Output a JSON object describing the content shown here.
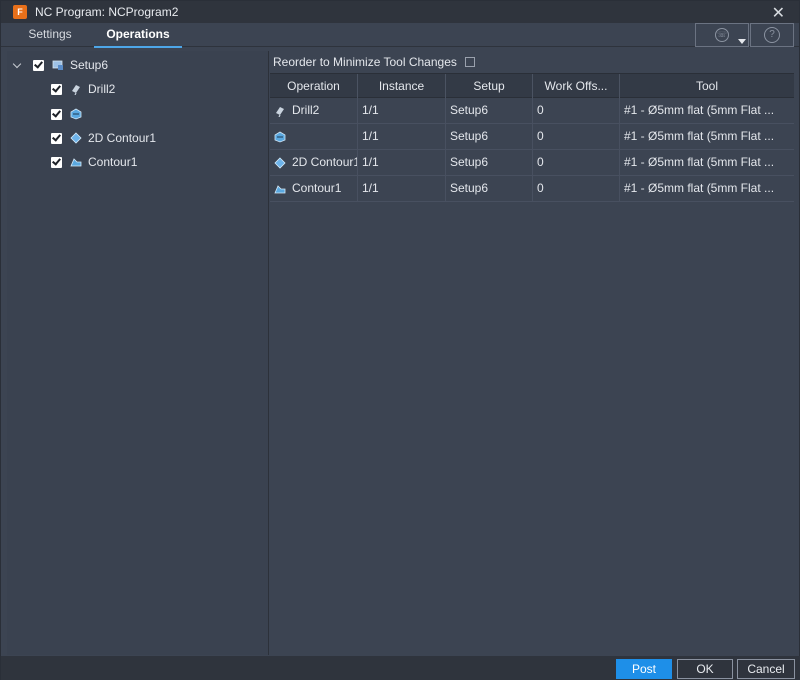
{
  "window": {
    "title": "NC Program: NCProgram2",
    "app_icon_letter": "F"
  },
  "tabs": [
    {
      "label": "Settings",
      "active": false
    },
    {
      "label": "Operations",
      "active": true
    }
  ],
  "toolbar": {
    "phone_icon": "phone-icon",
    "help_icon": "help-icon",
    "help_glyph": "?"
  },
  "tree": {
    "setup": {
      "label": "Setup6",
      "checked": true
    },
    "items": [
      {
        "label": "Drill2",
        "icon": "drill-icon",
        "checked": true
      },
      {
        "label": "",
        "icon": "3d-op-icon",
        "checked": true
      },
      {
        "label": "2D Contour1",
        "icon": "2d-contour-icon",
        "checked": true
      },
      {
        "label": "Contour1",
        "icon": "contour-icon",
        "checked": true
      }
    ]
  },
  "reorder": {
    "label": "Reorder to Minimize Tool Changes",
    "checked": false
  },
  "table": {
    "headers": [
      "Operation",
      "Instance",
      "Setup",
      "Work Offs...",
      "Tool"
    ],
    "rows": [
      {
        "operation": "Drill2",
        "instance": "1/1",
        "setup": "Setup6",
        "work_offset": "0",
        "tool": "#1 - Ø5mm flat (5mm Flat ..."
      },
      {
        "operation": "",
        "instance": "1/1",
        "setup": "Setup6",
        "work_offset": "0",
        "tool": "#1 - Ø5mm flat (5mm Flat ..."
      },
      {
        "operation": "2D Contour1",
        "instance": "1/1",
        "setup": "Setup6",
        "work_offset": "0",
        "tool": "#1 - Ø5mm flat (5mm Flat ..."
      },
      {
        "operation": "Contour1",
        "instance": "1/1",
        "setup": "Setup6",
        "work_offset": "0",
        "tool": "#1 - Ø5mm flat (5mm Flat ..."
      }
    ]
  },
  "buttons": {
    "post": "Post",
    "ok": "OK",
    "cancel": "Cancel"
  },
  "colors": {
    "accent": "#1e8fe8",
    "tab_underline": "#4da6e8",
    "background": "#3c4452"
  }
}
